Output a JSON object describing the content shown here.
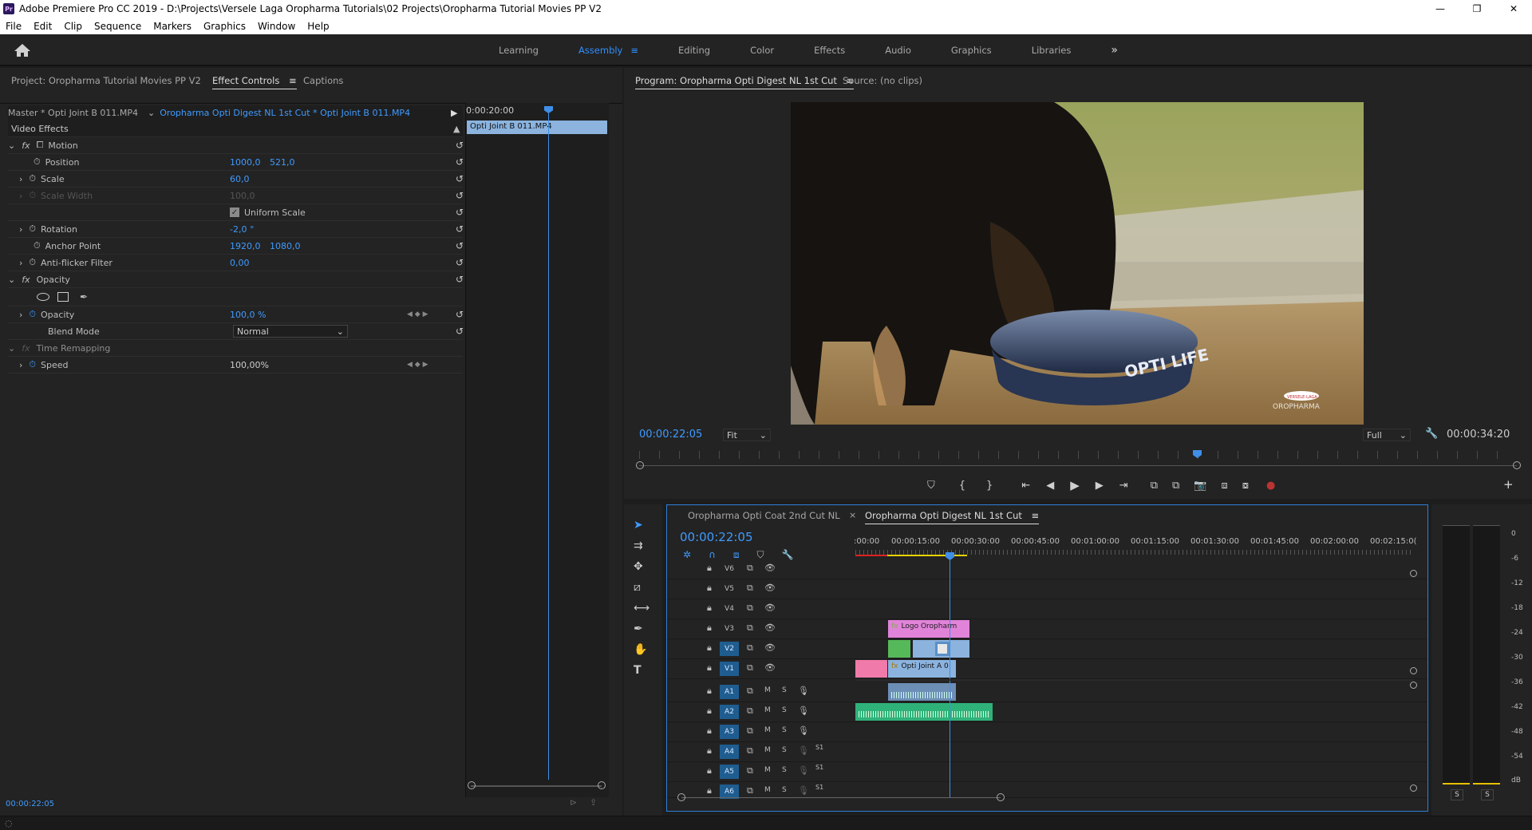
{
  "titlebar": {
    "title": "Adobe Premiere Pro CC 2019 - D:\\Projects\\Versele Laga Oropharma Tutorials\\02 Projects\\Oropharma Tutorial Movies PP V2",
    "app_icon": "Pr",
    "minimize": "—",
    "maximize": "❐",
    "close": "✕"
  },
  "menu": [
    "File",
    "Edit",
    "Clip",
    "Sequence",
    "Markers",
    "Graphics",
    "Window",
    "Help"
  ],
  "workspaces": {
    "tabs": [
      "Learning",
      "Assembly",
      "Editing",
      "Color",
      "Effects",
      "Audio",
      "Graphics",
      "Libraries"
    ],
    "active": "Assembly",
    "overflow": "»"
  },
  "left_panel": {
    "tabs": [
      "Project: Oropharma Tutorial Movies PP V2",
      "Effect Controls",
      "Captions"
    ],
    "master": "Master * Opti Joint B 011.MP4",
    "sequence_clip": "Oropharma Opti Digest NL 1st Cut * Opti Joint B 011.MP4",
    "mini_timecode": "0:00:20:00",
    "mini_clip": "Opti Joint B 011.MP4",
    "section": "Video Effects",
    "motion": "Motion",
    "position_label": "Position",
    "position_x": "1000,0",
    "position_y": "521,0",
    "scale_label": "Scale",
    "scale_value": "60,0",
    "scale_width_label": "Scale Width",
    "scale_width_value": "100,0",
    "uniform_scale": "Uniform Scale",
    "rotation_label": "Rotation",
    "rotation_value": "-2,0 °",
    "anchor_label": "Anchor Point",
    "anchor_x": "1920,0",
    "anchor_y": "1080,0",
    "antiflicker_label": "Anti-flicker Filter",
    "antiflicker_value": "0,00",
    "opacity_section": "Opacity",
    "opacity_label": "Opacity",
    "opacity_value": "100,0 %",
    "blend_label": "Blend Mode",
    "blend_value": "Normal",
    "time_remap": "Time Remapping",
    "speed_label": "Speed",
    "speed_value": "100,00%",
    "footer_timecode": "00:00:22:05"
  },
  "program": {
    "tab": "Program: Oropharma Opti Digest NL 1st Cut",
    "source_tab": "Source: (no clips)",
    "timecode": "00:00:22:05",
    "fit": "Fit",
    "quality": "Full",
    "duration": "00:00:34:20",
    "video_text_bowl": "OPTI LIFE",
    "video_text_logo": "OROPHARMA",
    "video_text_badge": "VERSELE-LAGA"
  },
  "timeline": {
    "tabs": [
      "Oropharma Opti Coat 2nd Cut NL",
      "Oropharma Opti Digest NL 1st Cut"
    ],
    "active_tab": "Oropharma Opti Digest NL 1st Cut",
    "timecode": "00:00:22:05",
    "ruler": [
      ":00:00",
      "00:00:15:00",
      "00:00:30:00",
      "00:00:45:00",
      "00:01:00:00",
      "00:01:15:00",
      "00:01:30:00",
      "00:01:45:00",
      "00:02:00:00",
      "00:02:15:0("
    ],
    "video_tracks": [
      "V6",
      "V5",
      "V4",
      "V3",
      "V2",
      "V1"
    ],
    "audio_tracks": [
      "A1",
      "A2",
      "A3",
      "A4",
      "A5",
      "A6"
    ],
    "m_label": "M",
    "s_label": "S",
    "ch_label": "S1",
    "clip_logo": "Logo Oropharm",
    "clip_opti": "Opti Joint A 0"
  },
  "meter": {
    "scale": [
      "0",
      "-6",
      "-12",
      "-18",
      "-24",
      "-30",
      "-36",
      "-42",
      "-48",
      "-54",
      "dB"
    ],
    "solo": [
      "S",
      "S"
    ]
  },
  "colors": {
    "accent": "#2f8fff",
    "bg": "#1d1d1d",
    "panel": "#232323",
    "clip_pink": "#e183d9",
    "clip_blue": "#8bb3de",
    "clip_green": "#35b57a"
  }
}
